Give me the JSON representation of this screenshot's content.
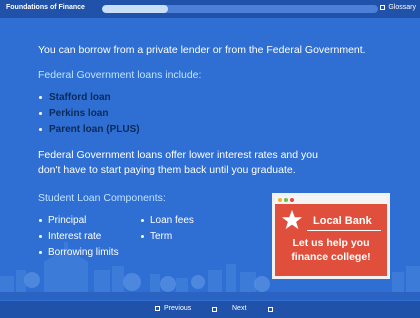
{
  "topbar": {
    "title": "Foundations of Finance",
    "progress": 0.24,
    "glossary_label": "Glossary"
  },
  "content": {
    "intro": "You can borrow from a private lender or from the Federal Government.",
    "federal_heading": "Federal Government loans include:",
    "federal_loans": [
      "Stafford loan",
      "Perkins loan",
      "Parent loan (PLUS)"
    ],
    "rates_text": "Federal Government loans offer lower interest rates and you don't have to start paying them back until you graduate.",
    "components_heading": "Student Loan Components:",
    "components_col1": [
      "Principal",
      "Interest rate",
      "Borrowing limits"
    ],
    "components_col2": [
      "Loan fees",
      "Term"
    ]
  },
  "ad": {
    "brand": "Local Bank",
    "slogan": "Let us help you finance college!",
    "icon": "star-icon"
  },
  "nav": {
    "previous_label": "Previous",
    "next_label": "Next"
  },
  "colors": {
    "background": "#2f6fd3",
    "bar": "#1f52a8",
    "heading": "#bfe3ff",
    "loan_text": "#0b2a5a",
    "ad_red": "#e04f3c"
  }
}
